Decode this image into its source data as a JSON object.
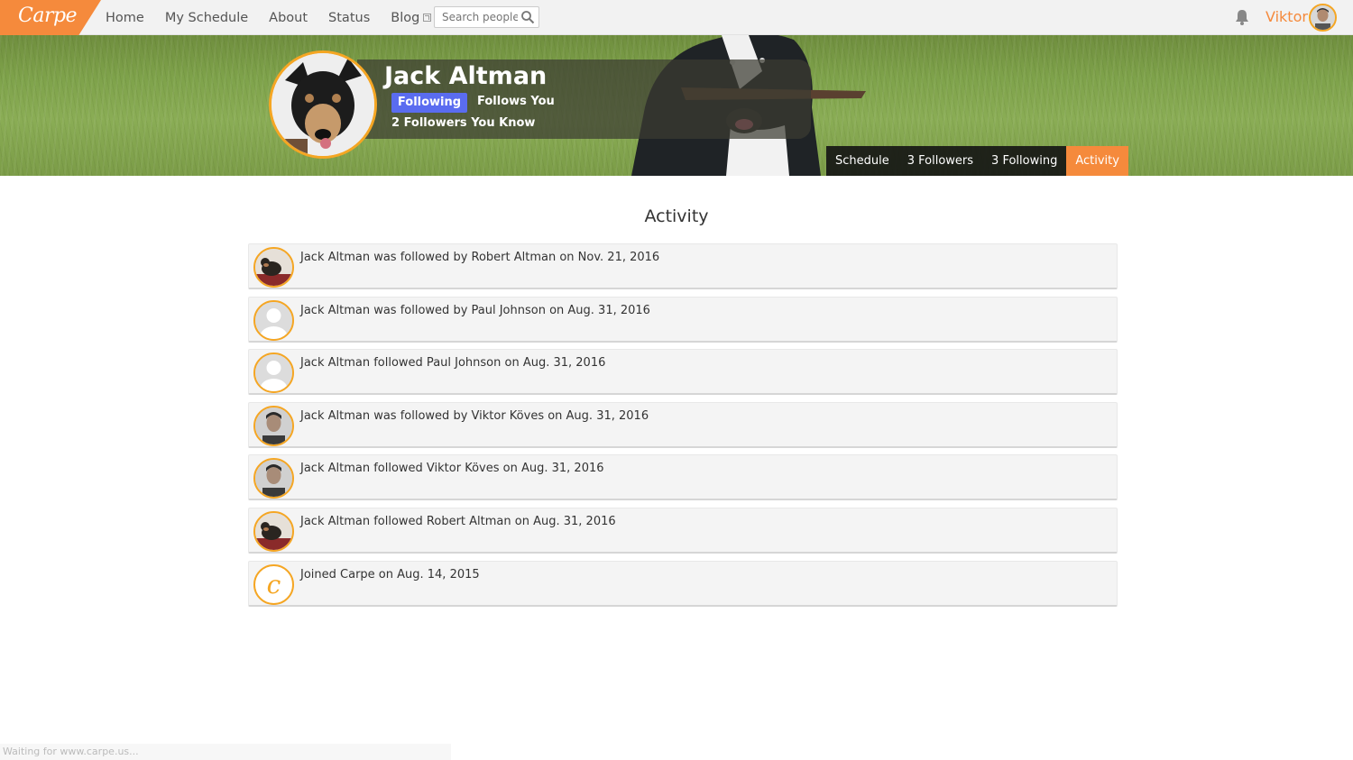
{
  "app": {
    "logo_text": "Carpe"
  },
  "nav": {
    "items": [
      {
        "label": "Home"
      },
      {
        "label": "My Schedule"
      },
      {
        "label": "About"
      },
      {
        "label": "Status"
      },
      {
        "label": "Blog"
      }
    ],
    "search_placeholder": "Search people",
    "user_name": "Viktor"
  },
  "profile": {
    "name": "Jack Altman",
    "following_label": "Following",
    "follows_you_label": "Follows You",
    "followers_you_know": "2 Followers You Know",
    "tabs": [
      {
        "label": "Schedule"
      },
      {
        "label": "3 Followers"
      },
      {
        "label": "3 Following"
      },
      {
        "label": "Activity"
      }
    ]
  },
  "activity": {
    "title": "Activity",
    "items": [
      {
        "text": "Jack Altman was followed by Robert Altman on Nov. 21, 2016",
        "avatar": "dog-photo"
      },
      {
        "text": "Jack Altman was followed by Paul Johnson on Aug. 31, 2016",
        "avatar": "default-avatar"
      },
      {
        "text": "Jack Altman followed Paul Johnson on Aug. 31, 2016",
        "avatar": "default-avatar"
      },
      {
        "text": "Jack Altman was followed by Viktor Köves on Aug. 31, 2016",
        "avatar": "person-photo"
      },
      {
        "text": "Jack Altman followed Viktor Köves on Aug. 31, 2016",
        "avatar": "person-photo"
      },
      {
        "text": "Jack Altman followed Robert Altman on Aug. 31, 2016",
        "avatar": "dog-photo"
      },
      {
        "text": "Joined Carpe on Aug. 14, 2015",
        "avatar": "carpe-logo"
      }
    ]
  },
  "status_bar": {
    "text": "Waiting for www.carpe.us..."
  },
  "colors": {
    "accent": "#f58a3c",
    "following_btn": "#5a6cf0",
    "avatar_ring": "#f5a623"
  }
}
